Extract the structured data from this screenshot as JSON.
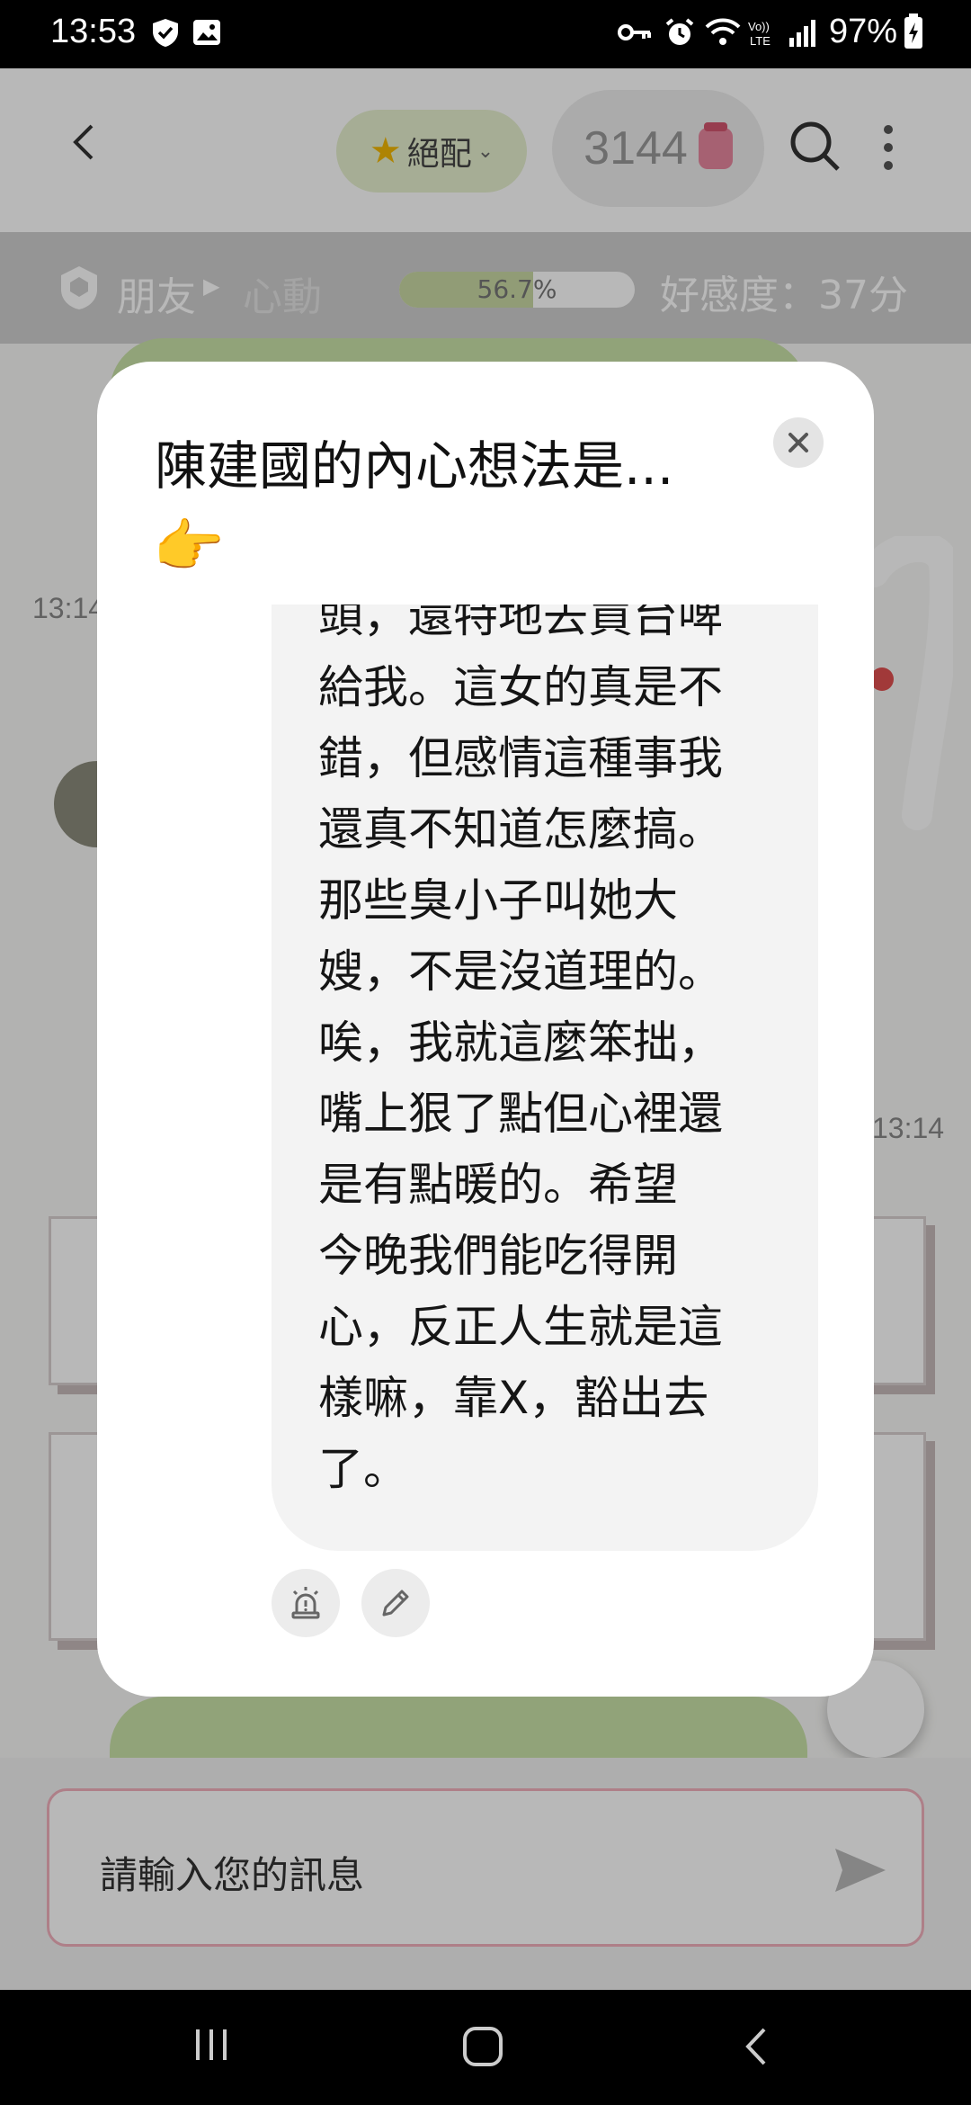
{
  "status_bar": {
    "time": "13:53",
    "battery": "97%",
    "icons": [
      "shield-check-icon",
      "image-icon",
      "key-icon",
      "alarm-icon",
      "wifi-icon",
      "volte-icon",
      "signal-icon",
      "battery-charging-icon"
    ]
  },
  "header": {
    "match_label": "絕配",
    "coins": "3144"
  },
  "relation": {
    "from": "朋友",
    "to": "心動",
    "progress_text": "56.7%",
    "progress_value": 0.567,
    "affinity": "好感度：37分"
  },
  "chat": {
    "times": [
      "13:14",
      "13:14"
    ]
  },
  "input": {
    "placeholder": "請輸入您的訊息"
  },
  "modal": {
    "title": "陳建國的內心想法是...",
    "emoji": "👉",
    "thought": "頭，還特地去買台啤\n給我。這女的真是不\n錯，但感情這種事我\n還真不知道怎麼搞。\n那些臭小子叫她大\n嫂，不是沒道理的。\n唉，我就這麼笨拙，\n嘴上狠了點但心裡還\n是有點暖的。希望\n今晚我們能吃得開\n心，反正人生就是這\n樣嘛，靠X，豁出去\n了。"
  },
  "colors": {
    "accent_green": "#c9e2a8",
    "progress_fill": "#c9d9a4",
    "input_border": "#f2b1bd"
  }
}
